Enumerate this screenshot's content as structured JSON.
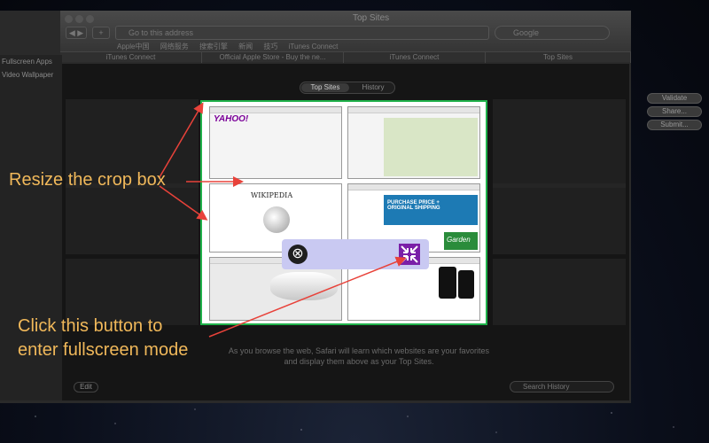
{
  "window": {
    "title": "Top Sites",
    "address_placeholder": "Go to this address",
    "search_placeholder": "Google",
    "bookmarks": [
      "Apple中国",
      "网络服务",
      "搜索引擎",
      "新闻",
      "技巧",
      "iTunes Connect"
    ],
    "tabs": [
      "iTunes Connect",
      "Official Apple Store - Buy the ne...",
      "iTunes Connect",
      "Top Sites"
    ]
  },
  "sidebar": {
    "items": [
      "Fullscreen Apps",
      "Video Wallpaper"
    ]
  },
  "right_panel": {
    "buttons": [
      "Validate",
      "Share...",
      "Submit..."
    ]
  },
  "top_sites": {
    "segments": [
      "Top Sites",
      "History"
    ],
    "footer_text": "As you browse the web, Safari will learn which websites are your favorites and display them above as your Top Sites.",
    "edit_label": "Edit",
    "search_history_placeholder": "Search History",
    "thumbnails": {
      "yahoo_logo": "YAHOO!",
      "wiki_title": "WIKIPEDIA",
      "ebay_promo": "PURCHASE PRICE + ORIGINAL SHIPPING",
      "garden_label": "Garden"
    }
  },
  "toolbar": {
    "close_glyph": "⊗"
  },
  "annotations": {
    "resize_label": "Resize the crop box",
    "fullscreen_label_line1": "Click this button to",
    "fullscreen_label_line2": "enter fullscreen mode"
  },
  "colors": {
    "annotation": "#f0b85a",
    "arrow": "#e8423a",
    "crop_border": "#1fb14a",
    "toolbar_bg": "#c9c9f2",
    "fullscreen_icon": "#7a1fa8"
  }
}
